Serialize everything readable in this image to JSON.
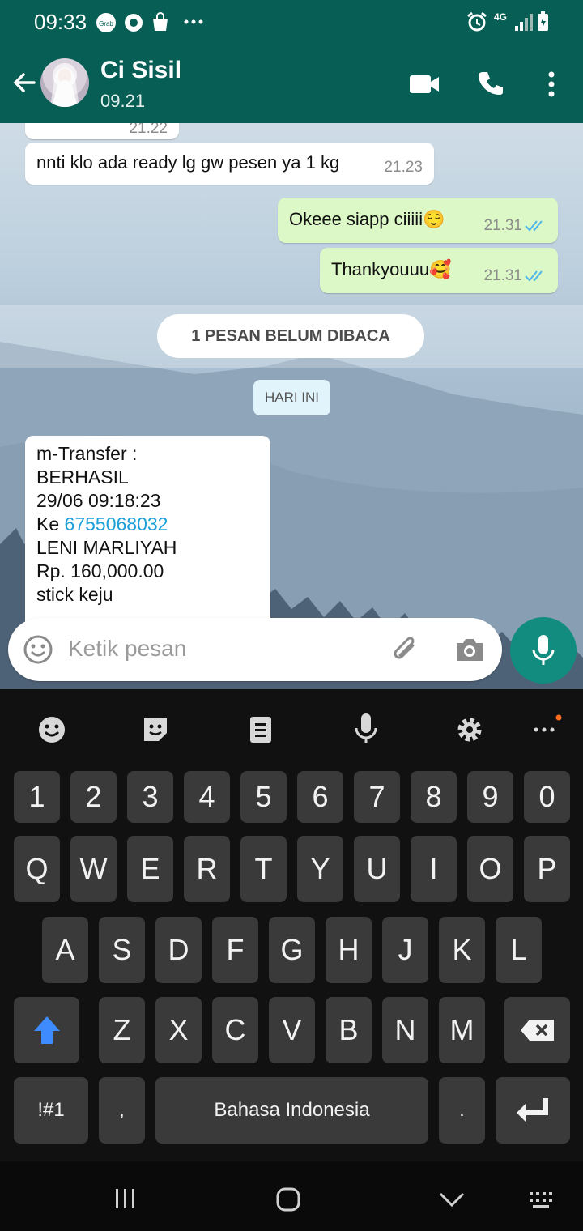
{
  "status_bar": {
    "time": "09:33",
    "network": "4G"
  },
  "header": {
    "contact_name": "Ci Sisil",
    "subtitle": "09.21"
  },
  "messages": [
    {
      "direction": "in",
      "text": "nnti klo ada ready lg gw pesen ya 1 kg",
      "time": "21.23"
    },
    {
      "direction": "out",
      "text": "Okeee siapp ciiiii😌",
      "time": "21.31"
    },
    {
      "direction": "out",
      "text": "Thankyouuu🥰",
      "time": "21.31"
    }
  ],
  "partial_time_above": "21.22",
  "unread_banner": "1 PESAN BELUM DIBACA",
  "date_chip": "HARI INI",
  "transfer_message": {
    "line1": "m-Transfer :",
    "line2": "BERHASIL",
    "line3": "29/06 09:18:23",
    "line4_prefix": "Ke ",
    "line4_account": "6755068032",
    "line5": "LENI MARLIYAH",
    "line6": "Rp. 160,000.00",
    "line7": "stick keju"
  },
  "input": {
    "placeholder": "Ketik pesan"
  },
  "keyboard": {
    "numbers": [
      "1",
      "2",
      "3",
      "4",
      "5",
      "6",
      "7",
      "8",
      "9",
      "0"
    ],
    "row1": [
      "Q",
      "W",
      "E",
      "R",
      "T",
      "Y",
      "U",
      "I",
      "O",
      "P"
    ],
    "row2": [
      "A",
      "S",
      "D",
      "F",
      "G",
      "H",
      "J",
      "K",
      "L"
    ],
    "row3": [
      "Z",
      "X",
      "C",
      "V",
      "B",
      "N",
      "M"
    ],
    "symbols_key": "!#1",
    "comma_key": ",",
    "space_label": "Bahasa Indonesia",
    "period_key": "."
  },
  "colors": {
    "header": "#075e54",
    "accent": "#128c7e",
    "outgoing_bubble": "#dcf8c6",
    "read_ticks": "#4fb6ec"
  }
}
